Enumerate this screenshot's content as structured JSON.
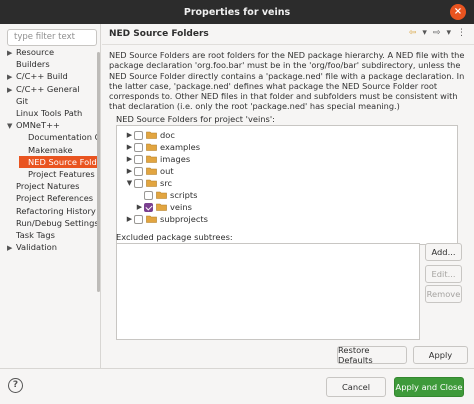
{
  "window": {
    "title": "Properties for veins",
    "close_glyph": "×"
  },
  "filter": {
    "placeholder": "type filter text"
  },
  "sidebar": {
    "items": [
      {
        "label": "Resource",
        "arrow": "▶"
      },
      {
        "label": "Builders",
        "arrow": ""
      },
      {
        "label": "C/C++ Build",
        "arrow": "▶"
      },
      {
        "label": "C/C++ General",
        "arrow": "▶"
      },
      {
        "label": "Git",
        "arrow": ""
      },
      {
        "label": "Linux Tools Path",
        "arrow": ""
      },
      {
        "label": "OMNeT++",
        "arrow": "▼"
      },
      {
        "label": "Documentation Ge",
        "arrow": ""
      },
      {
        "label": "Makemake",
        "arrow": ""
      },
      {
        "label": "NED Source Folder",
        "arrow": ""
      },
      {
        "label": "Project Features",
        "arrow": ""
      },
      {
        "label": "Project Natures",
        "arrow": ""
      },
      {
        "label": "Project References",
        "arrow": ""
      },
      {
        "label": "Refactoring History",
        "arrow": ""
      },
      {
        "label": "Run/Debug Settings",
        "arrow": ""
      },
      {
        "label": "Task Tags",
        "arrow": ""
      },
      {
        "label": "Validation",
        "arrow": "▶"
      }
    ],
    "selected_index": 9
  },
  "page": {
    "title": "NED Source Folders",
    "description": "NED Source Folders are root folders for the NED package hierarchy. A NED file with the package declaration 'org.foo.bar' must be in the 'org/foo/bar' subdirectory, unless the NED Source Folder directly contains a 'package.ned' file with a package declaration. In the latter case, 'package.ned' defines what package the NED Source Folder root corresponds to. Other NED files in that folder and subfolders must be consistent with that declaration (i.e. only the root 'package.ned' has special meaning.)",
    "folders_label": "NED Source Folders for project 'veins':",
    "excluded_label": "Excluded package subtrees:"
  },
  "folder_tree": [
    {
      "label": "doc",
      "arrow": "▶",
      "checked": false,
      "indent": 0
    },
    {
      "label": "examples",
      "arrow": "▶",
      "checked": false,
      "indent": 0
    },
    {
      "label": "images",
      "arrow": "▶",
      "checked": false,
      "indent": 0
    },
    {
      "label": "out",
      "arrow": "▶",
      "checked": false,
      "indent": 0
    },
    {
      "label": "src",
      "arrow": "▼",
      "checked": false,
      "indent": 0
    },
    {
      "label": "scripts",
      "arrow": "",
      "checked": false,
      "indent": 1
    },
    {
      "label": "veins",
      "arrow": "▶",
      "checked": true,
      "indent": 1
    },
    {
      "label": "subprojects",
      "arrow": "▶",
      "checked": false,
      "indent": 0
    }
  ],
  "buttons": {
    "add": "Add...",
    "edit": "Edit...",
    "remove": "Remove",
    "restore_defaults": "Restore Defaults",
    "apply": "Apply",
    "cancel": "Cancel",
    "apply_and_close": "Apply and Close"
  },
  "icons": {
    "help": "?",
    "nav_back": "⇦",
    "nav_back_menu": "▾",
    "nav_forward": "⇨",
    "nav_forward_menu": "▾",
    "view_menu": "⋮"
  },
  "colors": {
    "accent": "#e95420",
    "folder": "#e2a540",
    "check": "#7a3f8f",
    "primary_button": "#3e9a3a"
  }
}
